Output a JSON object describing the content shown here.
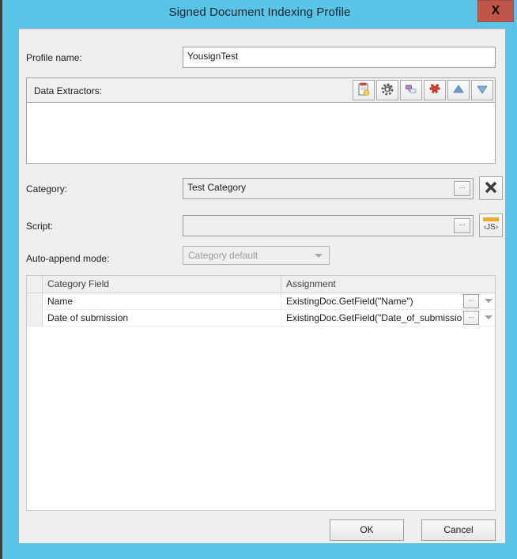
{
  "window": {
    "title": "Signed Document Indexing Profile",
    "close_label": "X",
    "titlebar_color": "#5bc5e8",
    "close_color": "#c0554a",
    "content_bg": "#efefef"
  },
  "form": {
    "profile_name_label": "Profile name:",
    "profile_name_value": "YousignTest",
    "profile_name_placeholder": "",
    "data_extractors_label": "Data Extractors:",
    "data_extractors_items": [],
    "category_label": "Category:",
    "category_value": "Test Category",
    "script_label": "Script:",
    "script_value": "",
    "auto_append_label": "Auto-append mode:",
    "auto_append_value": "Category default",
    "browse_label": "...",
    "js_label": "‹JS›"
  },
  "toolbar": {
    "buttons": [
      {
        "name": "new-extractor-icon",
        "title": "New"
      },
      {
        "name": "settings-gear-icon",
        "title": "Settings"
      },
      {
        "name": "duplicate-icon",
        "title": "Duplicate"
      },
      {
        "name": "delete-icon",
        "title": "Delete"
      },
      {
        "name": "move-up-icon",
        "title": "Move up"
      },
      {
        "name": "move-down-icon",
        "title": "Move down"
      }
    ]
  },
  "grid": {
    "columns": [
      "Category Field",
      "Assignment"
    ],
    "rows": [
      {
        "field": "Name",
        "assignment": "ExistingDoc.GetField(\"Name\")"
      },
      {
        "field": "Date of submission",
        "assignment": "ExistingDoc.GetField(\"Date_of_submissio"
      }
    ]
  },
  "footer": {
    "ok_label": "OK",
    "cancel_label": "Cancel"
  }
}
